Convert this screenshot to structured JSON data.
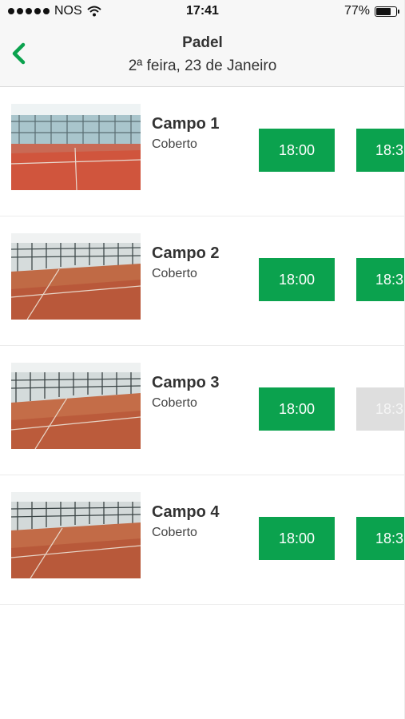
{
  "status_bar": {
    "carrier": "NOS",
    "time": "17:41",
    "battery": "77%",
    "battery_level": 0.77
  },
  "header": {
    "title": "Padel",
    "subtitle": "2ª feira, 23 de Janeiro"
  },
  "colors": {
    "accent": "#0ba24e",
    "unavailable": "#dedede"
  },
  "courts": [
    {
      "name": "Campo 1",
      "type": "Coberto",
      "slots": [
        {
          "time": "18:00",
          "available": true
        },
        {
          "time": "18:3",
          "available": true
        }
      ]
    },
    {
      "name": "Campo 2",
      "type": "Coberto",
      "slots": [
        {
          "time": "18:00",
          "available": true
        },
        {
          "time": "18:3",
          "available": true
        }
      ]
    },
    {
      "name": "Campo 3",
      "type": "Coberto",
      "slots": [
        {
          "time": "18:00",
          "available": true
        },
        {
          "time": "18:3",
          "available": false
        }
      ]
    },
    {
      "name": "Campo 4",
      "type": "Coberto",
      "slots": [
        {
          "time": "18:00",
          "available": true
        },
        {
          "time": "18:3",
          "available": true
        }
      ]
    }
  ]
}
